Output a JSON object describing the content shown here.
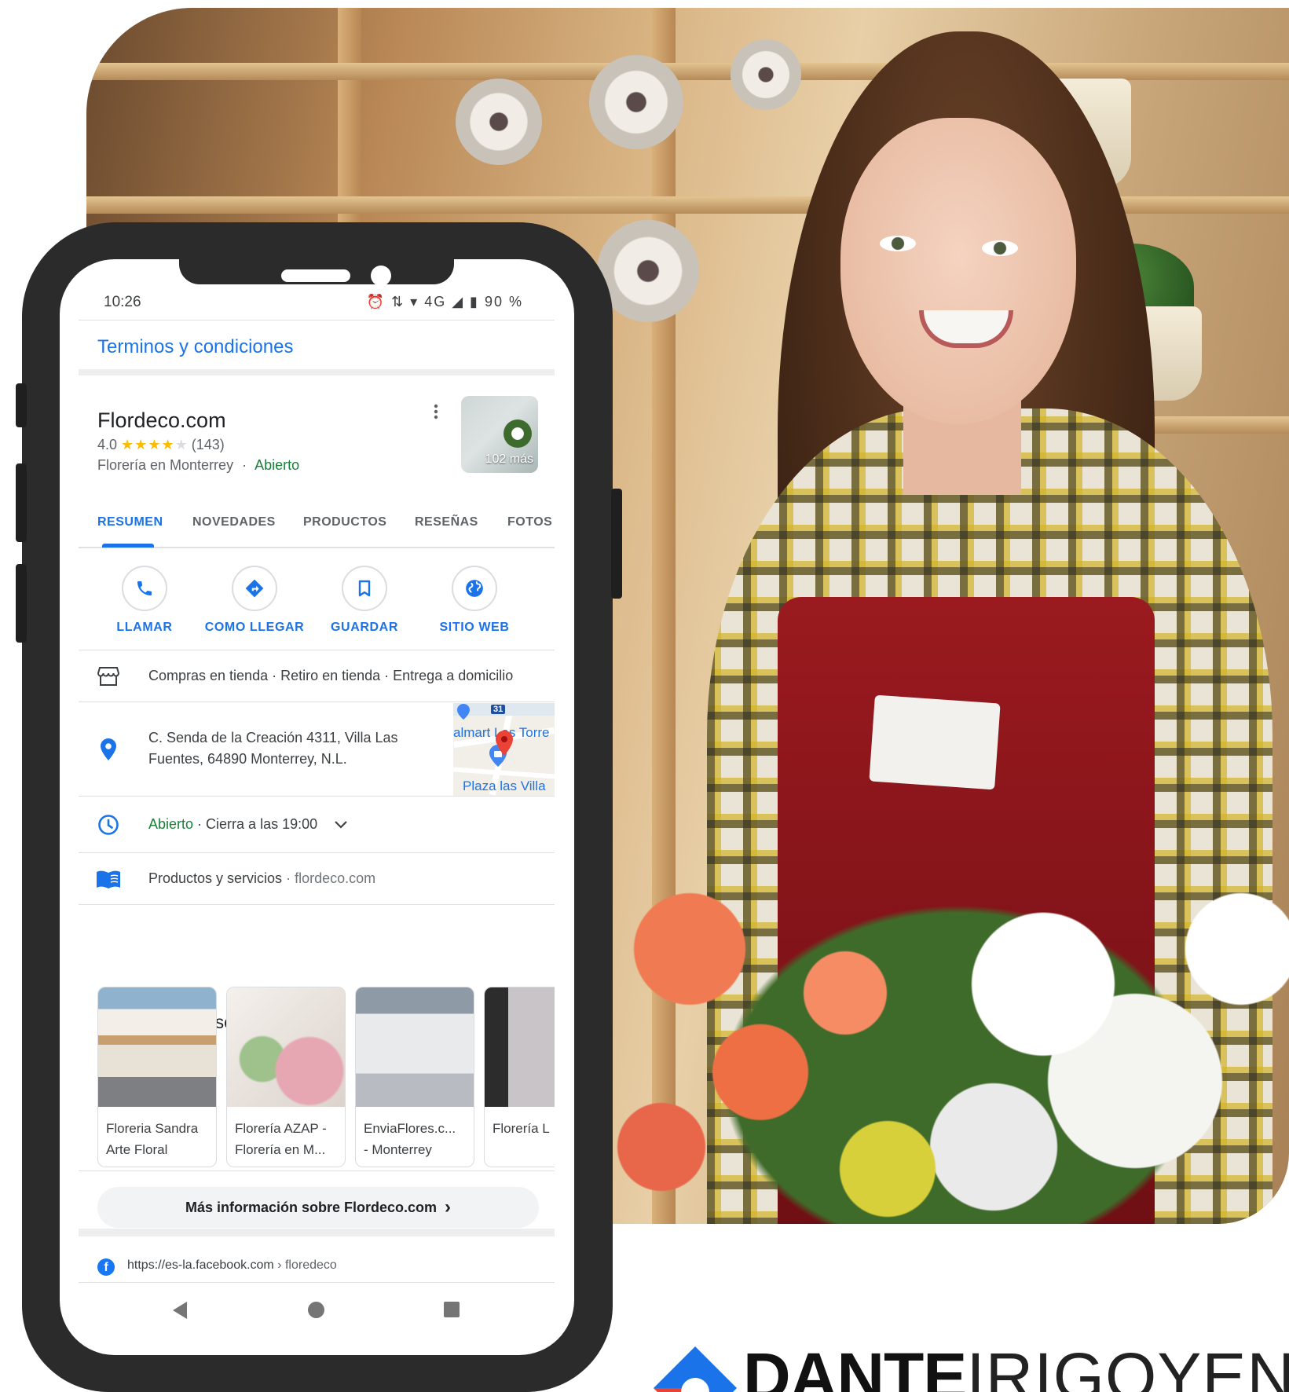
{
  "status_bar": {
    "time": "10:26",
    "icons": "⏰ ⇅ ▾ 4G ◢ ▮",
    "battery": "90 %"
  },
  "terms": {
    "label": "Terminos y condiciones"
  },
  "business": {
    "name": "Flordeco.com",
    "rating": "4.0",
    "reviews": "(143)",
    "category": "Florería en Monterrey",
    "separator": "·",
    "status": "Abierto",
    "photo_count": "102 más"
  },
  "tabs": [
    {
      "label": "RESUMEN",
      "active": true
    },
    {
      "label": "NOVEDADES",
      "active": false
    },
    {
      "label": "PRODUCTOS",
      "active": false
    },
    {
      "label": "RESEÑAS",
      "active": false
    },
    {
      "label": "FOTOS",
      "active": false
    }
  ],
  "actions": [
    {
      "label": "LLAMAR",
      "icon": "phone-icon"
    },
    {
      "label": "COMO LLEGAR",
      "icon": "directions-icon"
    },
    {
      "label": "GUARDAR",
      "icon": "bookmark-icon"
    },
    {
      "label": "SITIO WEB",
      "icon": "globe-icon"
    }
  ],
  "services": {
    "text": "Compras en tienda · Retiro en tienda · Entrega a domicilio"
  },
  "address": {
    "line1": "C. Senda de la Creación 4311, Villa Las",
    "line2": "Fuentes, 64890 Monterrey, N.L.",
    "map_label_1": "almart Las Torre",
    "map_label_2": "Plaza las Villa",
    "map_shield": "31"
  },
  "hours": {
    "status": "Abierto",
    "closes": " · Cierra a las 19:00"
  },
  "products": {
    "label": "Productos y servicios",
    "separator": " · ",
    "site": "flordeco.com"
  },
  "also_searched": {
    "heading": "También se buscó",
    "cards": [
      {
        "line1": "Floreria Sandra",
        "line2": "Arte Floral"
      },
      {
        "line1": "Florería AZAP -",
        "line2": "Florería en M..."
      },
      {
        "line1": "EnviaFlores.c...",
        "line2": "- Monterrey"
      },
      {
        "line1": "Florería L",
        "line2": ""
      }
    ]
  },
  "more_info": {
    "label": "Más información sobre Flordeco.com",
    "chevron": "›"
  },
  "facebook": {
    "url": "https://es-la.facebook.com",
    "path": " › floredeco"
  },
  "brand": {
    "bold": "DANTE",
    "light": "IRIGOYEN"
  },
  "colors": {
    "accent": "#1a73e8",
    "open_green": "#188038",
    "star": "#fbbc04"
  }
}
